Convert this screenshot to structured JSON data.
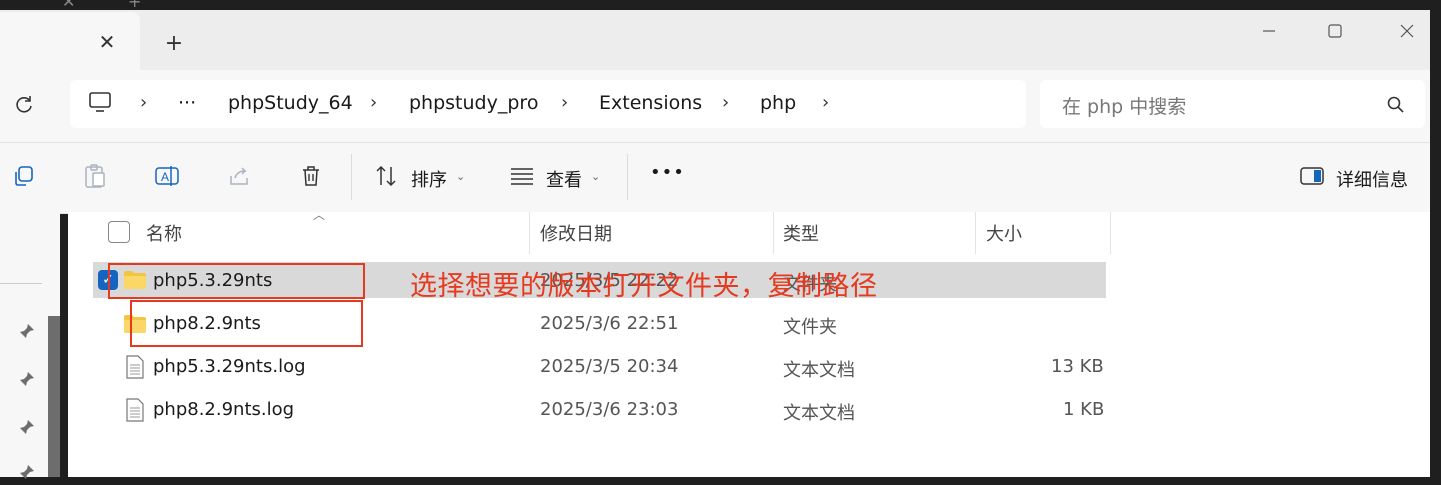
{
  "window": {
    "new_tab_glyph": "+",
    "close_tab_glyph": "✕"
  },
  "address": {
    "overflow": "···",
    "crumbs": [
      "phpStudy_64",
      "phpstudy_pro",
      "Extensions",
      "php"
    ],
    "search_placeholder": "在 php 中搜索"
  },
  "toolbar": {
    "sort_label": "排序",
    "view_label": "查看",
    "more_glyph": "•••",
    "details_label": "详细信息"
  },
  "columns": {
    "name": "名称",
    "modified": "修改日期",
    "type": "类型",
    "size": "大小"
  },
  "files": [
    {
      "name": "php5.3.29nts",
      "date": "2025/3/5 22:22",
      "type": "文件夹",
      "size": "",
      "icon": "folder-icon",
      "selected": true
    },
    {
      "name": "php8.2.9nts",
      "date": "2025/3/6 22:51",
      "type": "文件夹",
      "size": "",
      "icon": "folder-icon",
      "selected": false
    },
    {
      "name": "php5.3.29nts.log",
      "date": "2025/3/5 20:34",
      "type": "文本文档",
      "size": "13 KB",
      "icon": "text-file-icon",
      "selected": false
    },
    {
      "name": "php8.2.9nts.log",
      "date": "2025/3/6 23:03",
      "type": "文本文档",
      "size": "1 KB",
      "icon": "text-file-icon",
      "selected": false
    }
  ],
  "annotation": {
    "text": "选择想要的版本打开文件夹，复制路径",
    "color": "#e53a20"
  },
  "colors": {
    "accent": "#1565c0",
    "folder": "#f4c542",
    "selection": "#d9d9d9"
  }
}
